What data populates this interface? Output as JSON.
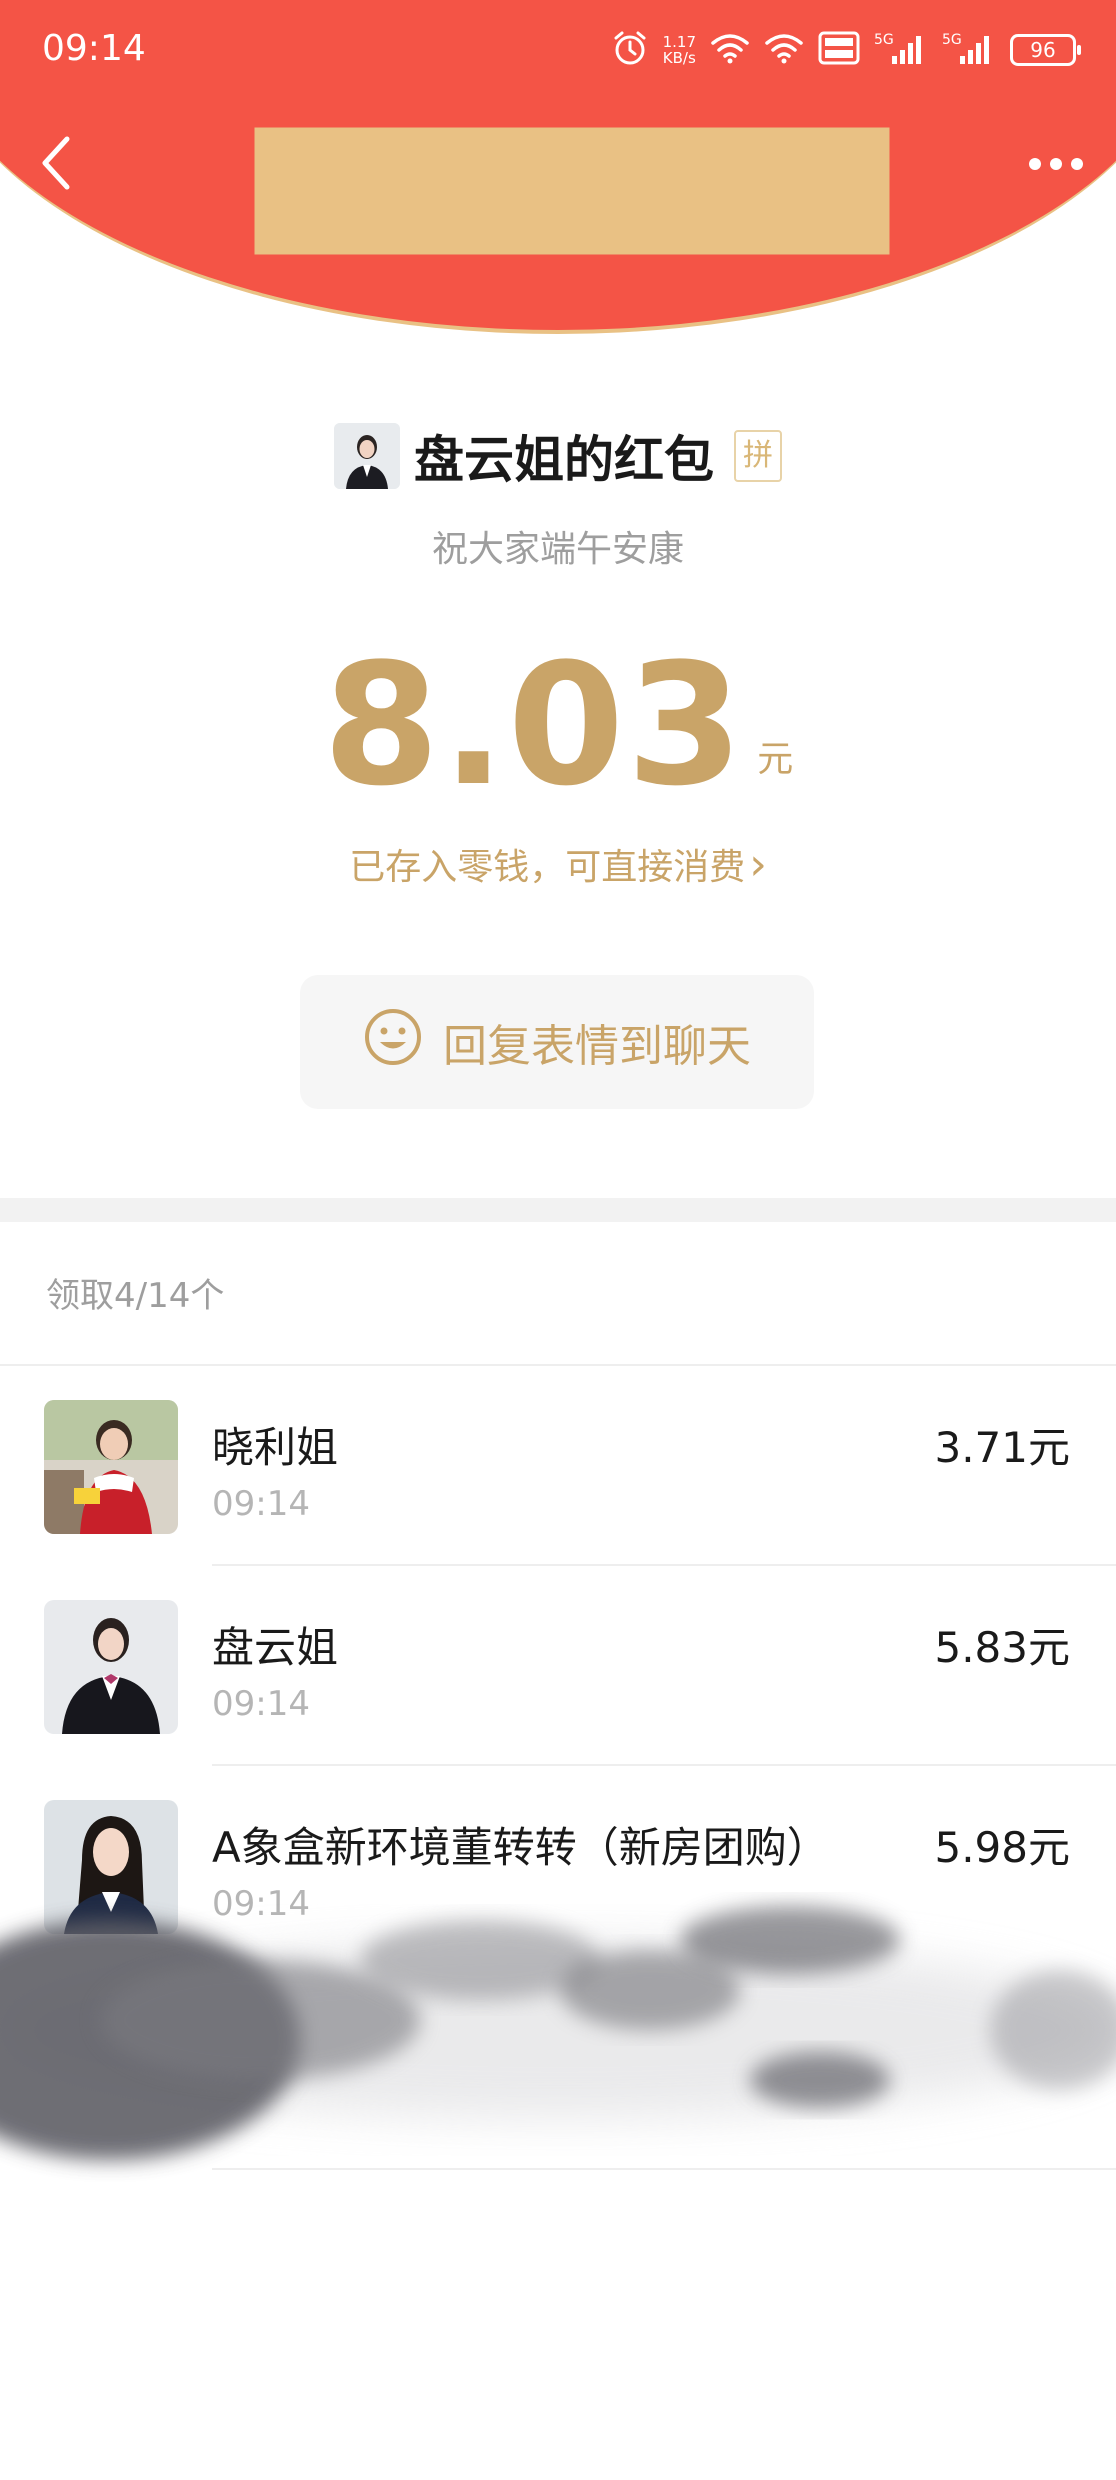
{
  "status_bar": {
    "time": "09:14",
    "net_speed_top": "1.17",
    "net_speed_bottom": "KB/s",
    "battery": "96",
    "icons": [
      "alarm-icon",
      "wifi-icon",
      "wifi-icon",
      "hd-icon",
      "signal-5g-icon",
      "signal-5g-icon",
      "battery-icon"
    ]
  },
  "nav": {
    "back_icon": "chevron-left-icon",
    "more_icon": "more-horizontal-icon"
  },
  "envelope": {
    "sender_title": "盘云姐的红包",
    "pin_tag": "拼",
    "blessing": "祝大家端午安康",
    "amount": "8.03",
    "unit": "元",
    "stored_text": "已存入零钱，可直接消费",
    "stored_arrow": "›"
  },
  "reply": {
    "label": "回复表情到聊天",
    "icon": "smiley-icon"
  },
  "received": {
    "count_label": "领取4/14个"
  },
  "list": [
    {
      "name": "晓利姐",
      "time": "09:14",
      "amount": "3.71元"
    },
    {
      "name": "盘云姐",
      "time": "09:14",
      "amount": "5.83元"
    },
    {
      "name": "A象盒新环境董转转（新房团购）",
      "time": "09:14",
      "amount": "5.98元"
    }
  ],
  "colors": {
    "header_red": "#f45446",
    "gold": "#c9a468",
    "gold_border": "#e9c184"
  }
}
